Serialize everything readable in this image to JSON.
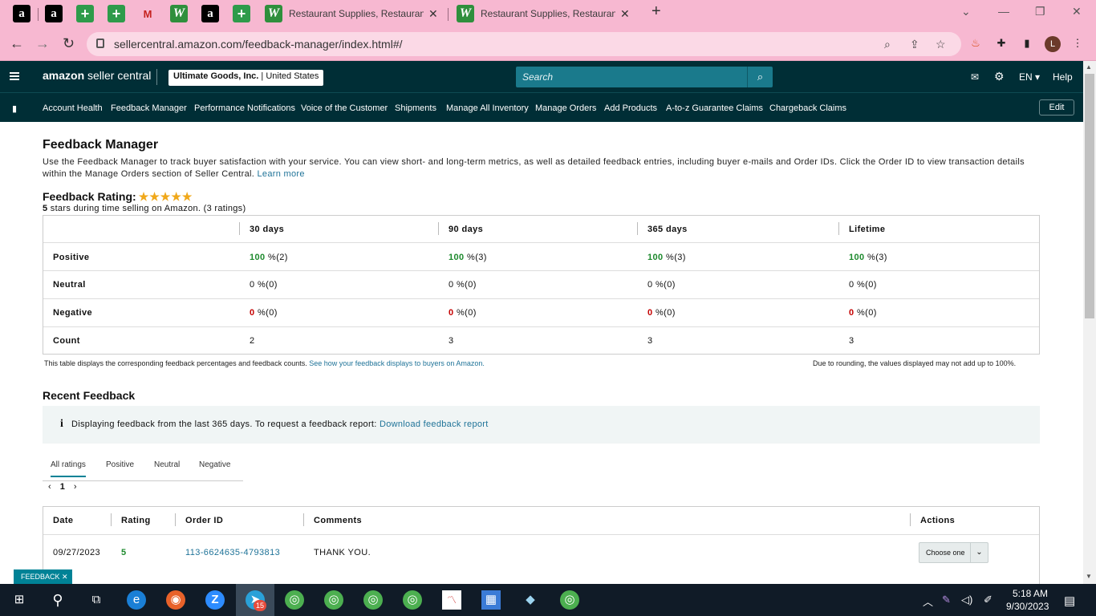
{
  "browser": {
    "tabs": [
      {
        "title": "Restaurant Supplies, Restaurant",
        "close": "✕"
      },
      {
        "title": "Restaurant Supplies, Restaurant",
        "close": "✕"
      }
    ],
    "new_tab": "+",
    "url": "sellercentral.amazon.com/feedback-manager/index.html#/",
    "profile_initial": "L"
  },
  "header": {
    "logo_prefix": "amazon",
    "logo_suffix": "seller central",
    "account_name": "Ultimate Goods, Inc.",
    "account_market": "United States",
    "search_placeholder": "Search",
    "language": "EN",
    "help": "Help"
  },
  "nav": {
    "items": [
      "Account Health",
      "Feedback Manager",
      "Performance Notifications",
      "Voice of the Customer",
      "Shipments",
      "Manage All Inventory",
      "Manage Orders",
      "Add Products",
      "A-to-z Guarantee Claims",
      "Chargeback Claims"
    ],
    "edit": "Edit"
  },
  "page": {
    "title": "Feedback Manager",
    "intro": "Use the Feedback Manager to track buyer satisfaction with your service. You can view short- and long-term metrics, as well as detailed feedback entries, including buyer e-mails and Order IDs. Click the Order ID to view transaction details within the Manage Orders section of Seller Central.",
    "learn_more": "Learn more",
    "rating_title": "Feedback Rating:",
    "rating_stars": "★★★★★",
    "rating_sub_bold": "5",
    "rating_sub": " stars during time selling on Amazon. (3 ratings)",
    "rating_value": 5
  },
  "summary": {
    "columns": [
      "30 days",
      "90 days",
      "365 days",
      "Lifetime"
    ],
    "rows": [
      {
        "label": "Positive",
        "cells": [
          {
            "v": "100",
            "s": " %(2)"
          },
          {
            "v": "100",
            "s": " %(3)"
          },
          {
            "v": "100",
            "s": " %(3)"
          },
          {
            "v": "100",
            "s": " %(3)"
          }
        ]
      },
      {
        "label": "Neutral",
        "cells": [
          {
            "v": "0",
            "s": " %(0)"
          },
          {
            "v": "0",
            "s": " %(0)"
          },
          {
            "v": "0",
            "s": " %(0)"
          },
          {
            "v": "0",
            "s": " %(0)"
          }
        ]
      },
      {
        "label": "Negative",
        "cells": [
          {
            "v": "0",
            "s": " %(0)"
          },
          {
            "v": "0",
            "s": " %(0)"
          },
          {
            "v": "0",
            "s": " %(0)"
          },
          {
            "v": "0",
            "s": " %(0)"
          }
        ]
      },
      {
        "label": "Count",
        "cells": [
          {
            "v": "2",
            "s": ""
          },
          {
            "v": "3",
            "s": ""
          },
          {
            "v": "3",
            "s": ""
          },
          {
            "v": "3",
            "s": ""
          }
        ]
      }
    ],
    "footnote_left": "This table displays the corresponding feedback percentages and feedback counts.",
    "footnote_link": "See how your feedback displays to buyers on Amazon.",
    "footnote_right": "Due to rounding, the values displayed may not add up to 100%."
  },
  "recent": {
    "title": "Recent Feedback",
    "info_text": "Displaying feedback from the last 365 days. To request a feedback report:",
    "info_link": "Download feedback report",
    "tabs": [
      "All ratings",
      "Positive",
      "Neutral",
      "Negative"
    ],
    "page": "1",
    "columns": [
      "Date",
      "Rating",
      "Order ID",
      "Comments",
      "Actions"
    ],
    "rows": [
      {
        "date": "09/27/2023",
        "rating": "5",
        "order_id": "113-6624635-4793813",
        "comment": "THANK YOU.",
        "action": "Choose one"
      }
    ]
  },
  "feedback_tab": "FEEDBACK ✕",
  "taskbar": {
    "time": "5:18 AM",
    "date": "9/30/2023",
    "badge": "15"
  }
}
